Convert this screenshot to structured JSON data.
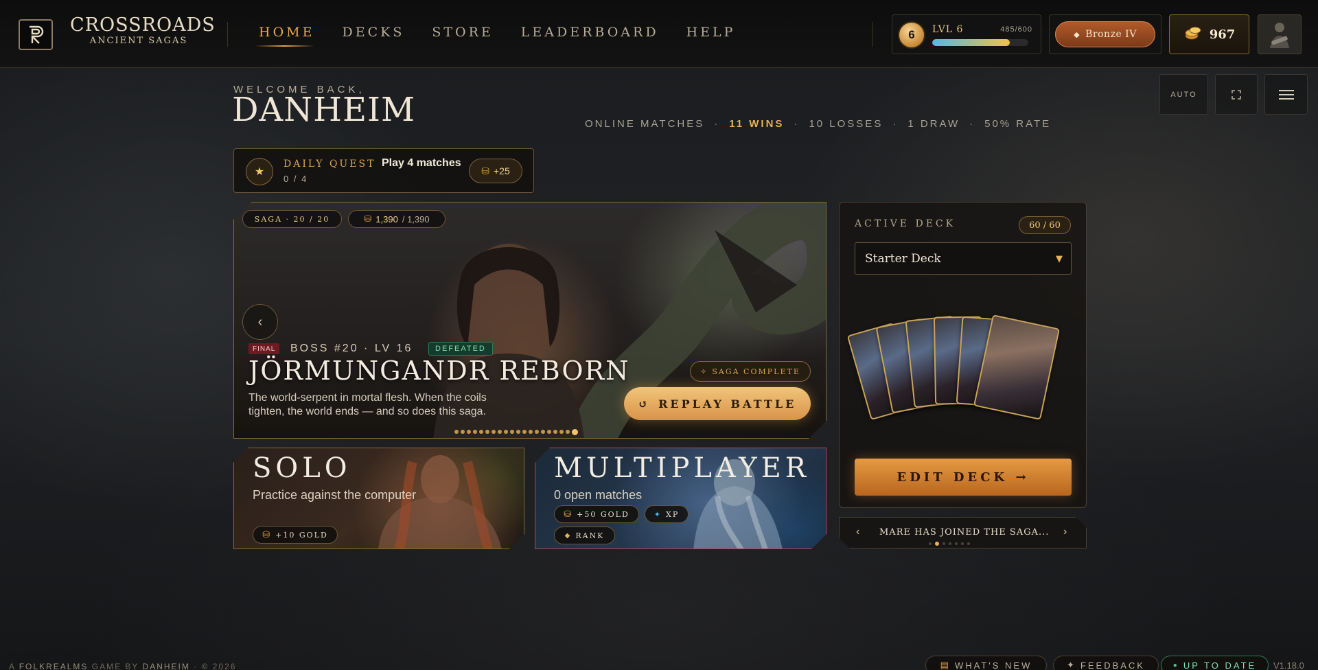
{
  "brand": {
    "title": "CROSSROADS",
    "subtitle": "ANCIENT SAGAS"
  },
  "nav": {
    "items": [
      "HOME",
      "DECKS",
      "STORE",
      "LEADERBOARD",
      "HELP"
    ],
    "active": "HOME"
  },
  "player": {
    "level_number": "6",
    "level_label": "LVL 6",
    "xp_text": "485/600",
    "xp_progress": 0.81,
    "rank": "Bronze IV",
    "gold": "967"
  },
  "controls": {
    "auto_label": "AUTO"
  },
  "welcome": {
    "subtitle": "WELCOME BACK,",
    "name": "DANHEIM"
  },
  "stats": {
    "online": "ONLINE MATCHES",
    "wins": "11 WINS",
    "losses": "10 LOSSES",
    "draws": "1 DRAW",
    "rate": "50% RATE"
  },
  "quest": {
    "label": "DAILY QUEST",
    "title": "Play 4 matches",
    "progress": "0 / 4",
    "reward": "+25"
  },
  "saga": {
    "progress": "SAGA · 20 / 20",
    "gold_current": "1,390",
    "gold_total": "/ 1,390",
    "final_tag": "FINAL",
    "boss_info": "BOSS #20 · LV 16",
    "status": "DEFEATED",
    "boss_name": "JÖRMUNGANDR REBORN",
    "description": "The world-serpent in mortal flesh. When the coils tighten, the world ends — and so does this saga.",
    "complete_label": "SAGA COMPLETE",
    "replay_label": "REPLAY BATTLE",
    "slides": 20,
    "current_slide": 20
  },
  "modes": {
    "solo": {
      "title": "SOLO",
      "description": "Practice against the computer",
      "reward": "+10 GOLD"
    },
    "multiplayer": {
      "title": "MULTIPLAYER",
      "description": "0 open matches",
      "rewards": [
        "+50 GOLD",
        "XP",
        "RANK"
      ]
    }
  },
  "deck": {
    "label": "ACTIVE DECK",
    "count": "60 / 60",
    "selected": "Starter Deck",
    "edit_label": "EDIT DECK →"
  },
  "news": {
    "text": "MARE HAS JOINED THE SAGA...",
    "count": 7,
    "current": 2
  },
  "footer": {
    "prefix": "A",
    "studio": "FOLKREALMS",
    "middle": "GAME BY",
    "author": "DANHEIM",
    "year": "· © 2026",
    "whats_new": "WHAT'S NEW",
    "feedback": "FEEDBACK",
    "status": "UP TO DATE",
    "version": "V1.18.0"
  },
  "colors": {
    "accent": "#e9a94e",
    "gold": "#f0c868",
    "success": "#7fe0b0",
    "danger": "#6e1a22"
  }
}
